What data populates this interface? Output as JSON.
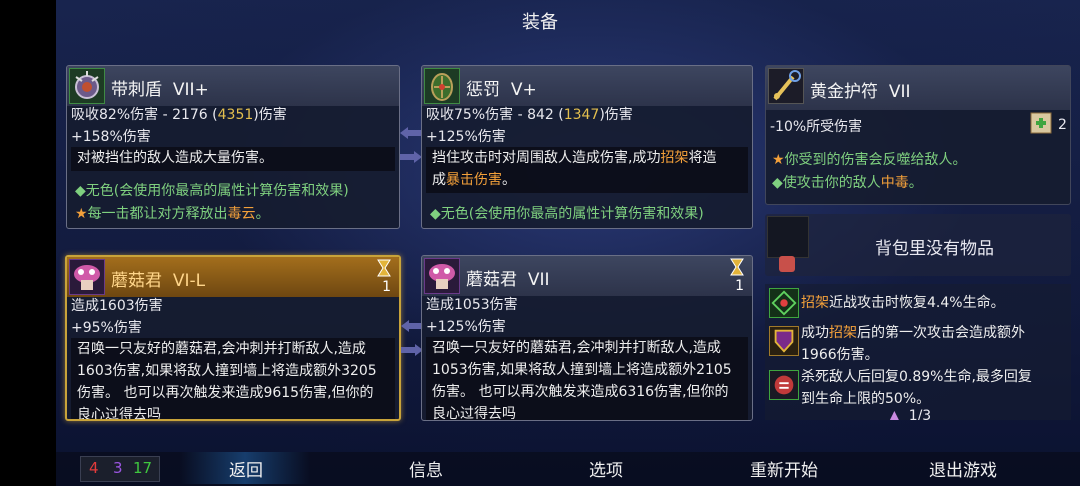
{
  "screen_title": "装备",
  "cards": {
    "c1": {
      "name": "带刺盾",
      "tier": "VII+",
      "stat1_pre": "吸收82%伤害 - 2176 (",
      "stat1_gold": "4351",
      "stat1_post": ")伤害",
      "stat2": "+158%伤害",
      "desc": "对被挡住的敌人造成大量伤害。",
      "trait1": "◆无色(会使用你最高的属性计算伤害和效果)",
      "trait2_pre": "每一击都让对方释放出",
      "trait2_hl": "毒云",
      "trait2_post": "。"
    },
    "c2": {
      "name": "惩罚",
      "tier": "V+",
      "stat1_pre": "吸收75%伤害 - 842 (",
      "stat1_gold": "1347",
      "stat1_post": ")伤害",
      "stat2": "+125%伤害",
      "desc_a": "挡住攻击时对周围敌人造成伤害,成功",
      "desc_hl1": "招架",
      "desc_b": "将造",
      "desc_c": "成",
      "desc_hl2": "暴击伤害",
      "desc_d": "。",
      "trait1": "◆无色(会使用你最高的属性计算伤害和效果)"
    },
    "c3": {
      "name": "黄金护符",
      "tier": "VII",
      "stat1": "-10%所受伤害",
      "scroll_count": "2",
      "trait1": "你受到的伤害会反噬给敌人。",
      "trait2_pre": "◆使攻击你的敌人",
      "trait2_hl": "中毒",
      "trait2_post": "。"
    },
    "c4": {
      "name": "蘑菇君",
      "tier": "VI-L",
      "count": "1",
      "stat1": "造成1603伤害",
      "stat2": "+95%伤害",
      "line1": "召唤一只友好的蘑菇君,会冲刺并打断敌人,造成",
      "line2": "1603伤害,如果将敌人撞到墙上将造成额外3205",
      "line3": "伤害。 也可以再次触发来造成9615伤害,但你的",
      "line4": "良心过得去吗"
    },
    "c5": {
      "name": "蘑菇君",
      "tier": "VII",
      "count": "1",
      "stat1": "造成1053伤害",
      "stat2": "+125%伤害",
      "line1": "召唤一只友好的蘑菇君,会冲刺并打断敌人,造成",
      "line2": "1053伤害,如果将敌人撞到墙上将造成额外2105",
      "line3": "伤害。 也可以再次触发来造成6316伤害,但你的",
      "line4": "良心过得去吗"
    }
  },
  "backpack": {
    "empty_text": "背包里没有物品"
  },
  "passives": {
    "p1_hl": "招架",
    "p1_text": "近战攻击时恢复4.4%生命。",
    "p2_pre": "成功",
    "p2_hl": "招架",
    "p2_post": "后的第一次攻击会造成额外",
    "p2_line2": "1966伤害。",
    "p3_line1": "杀死敌人后回复0.89%生命,最多回复",
    "p3_line2": "到生命上限的50%。",
    "page": "1/3"
  },
  "stats": {
    "brutality": "4",
    "tactics": "3",
    "survival": "17",
    "colors": {
      "brutality": "#e23b3b",
      "tactics": "#9a55e0",
      "survival": "#3fc63f"
    }
  },
  "menu": {
    "back": "返回",
    "info": "信息",
    "options": "选项",
    "restart": "重新开始",
    "quit": "退出游戏"
  }
}
